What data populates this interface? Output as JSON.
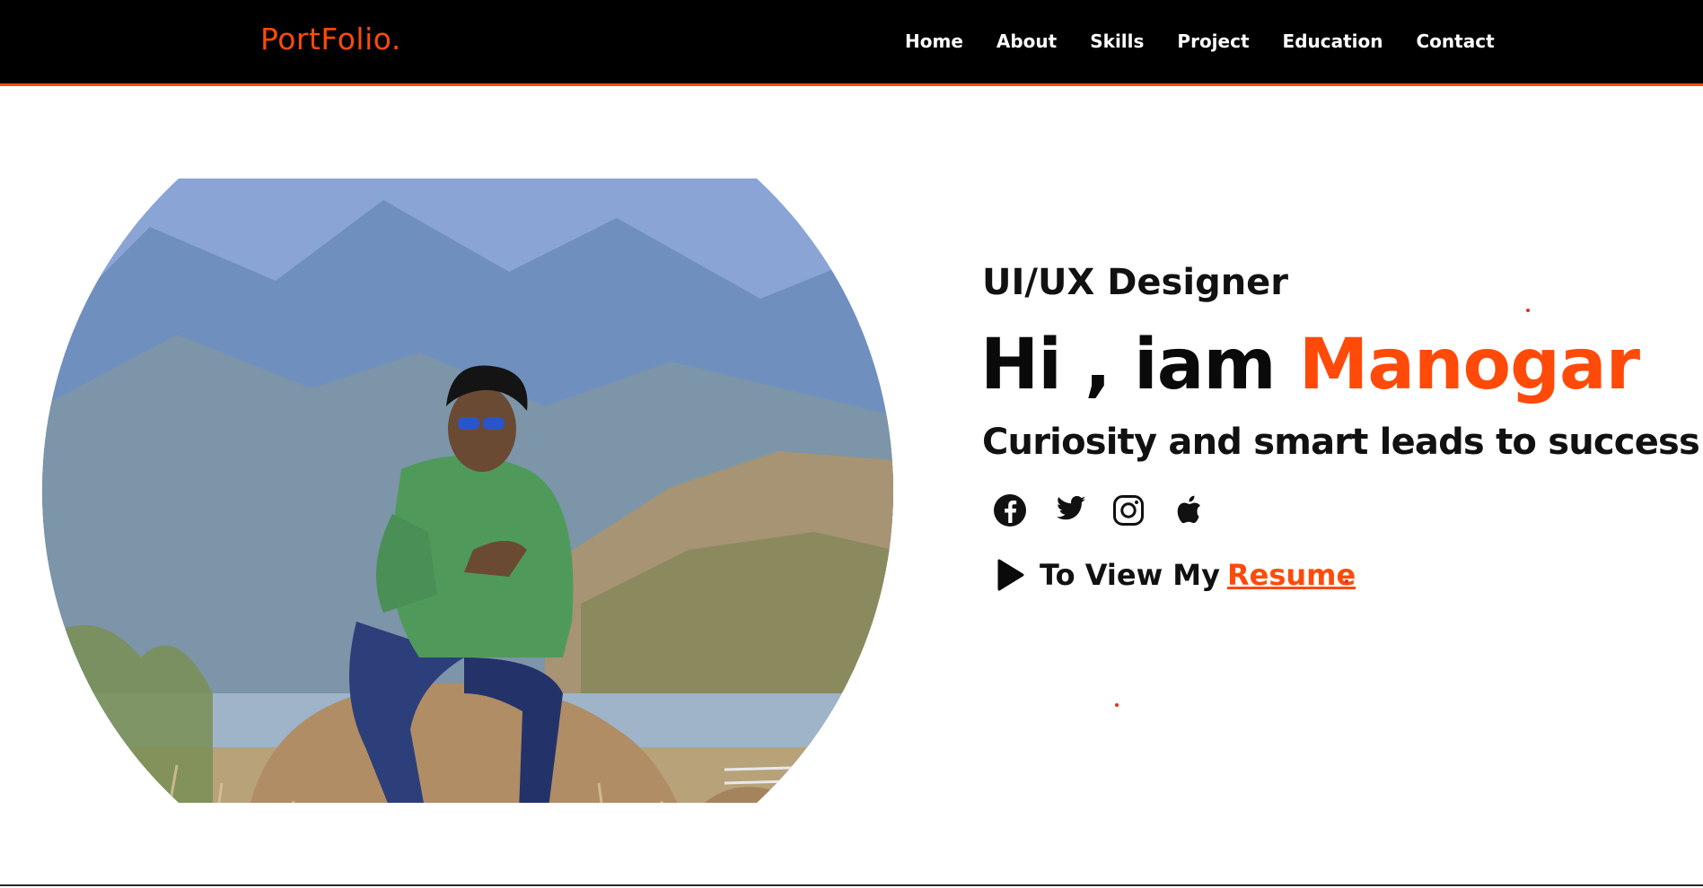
{
  "nav": {
    "logo": "PortFolio.",
    "links": [
      "Home",
      "About",
      "Skills",
      "Project",
      "Education",
      "Contact"
    ]
  },
  "hero": {
    "role": "UI/UX Designer",
    "greeting": "Hi , iam ",
    "name": "Manogar",
    "tagline": "Curiosity and smart leads to success.",
    "resume_prefix": "To View My",
    "resume_link": "Resume",
    "social_icons": [
      "facebook-icon",
      "twitter-icon",
      "instagram-icon",
      "apple-icon"
    ]
  },
  "colors": {
    "accent": "#ff4a0a",
    "navbar_bg": "#000000",
    "text": "#111111"
  }
}
